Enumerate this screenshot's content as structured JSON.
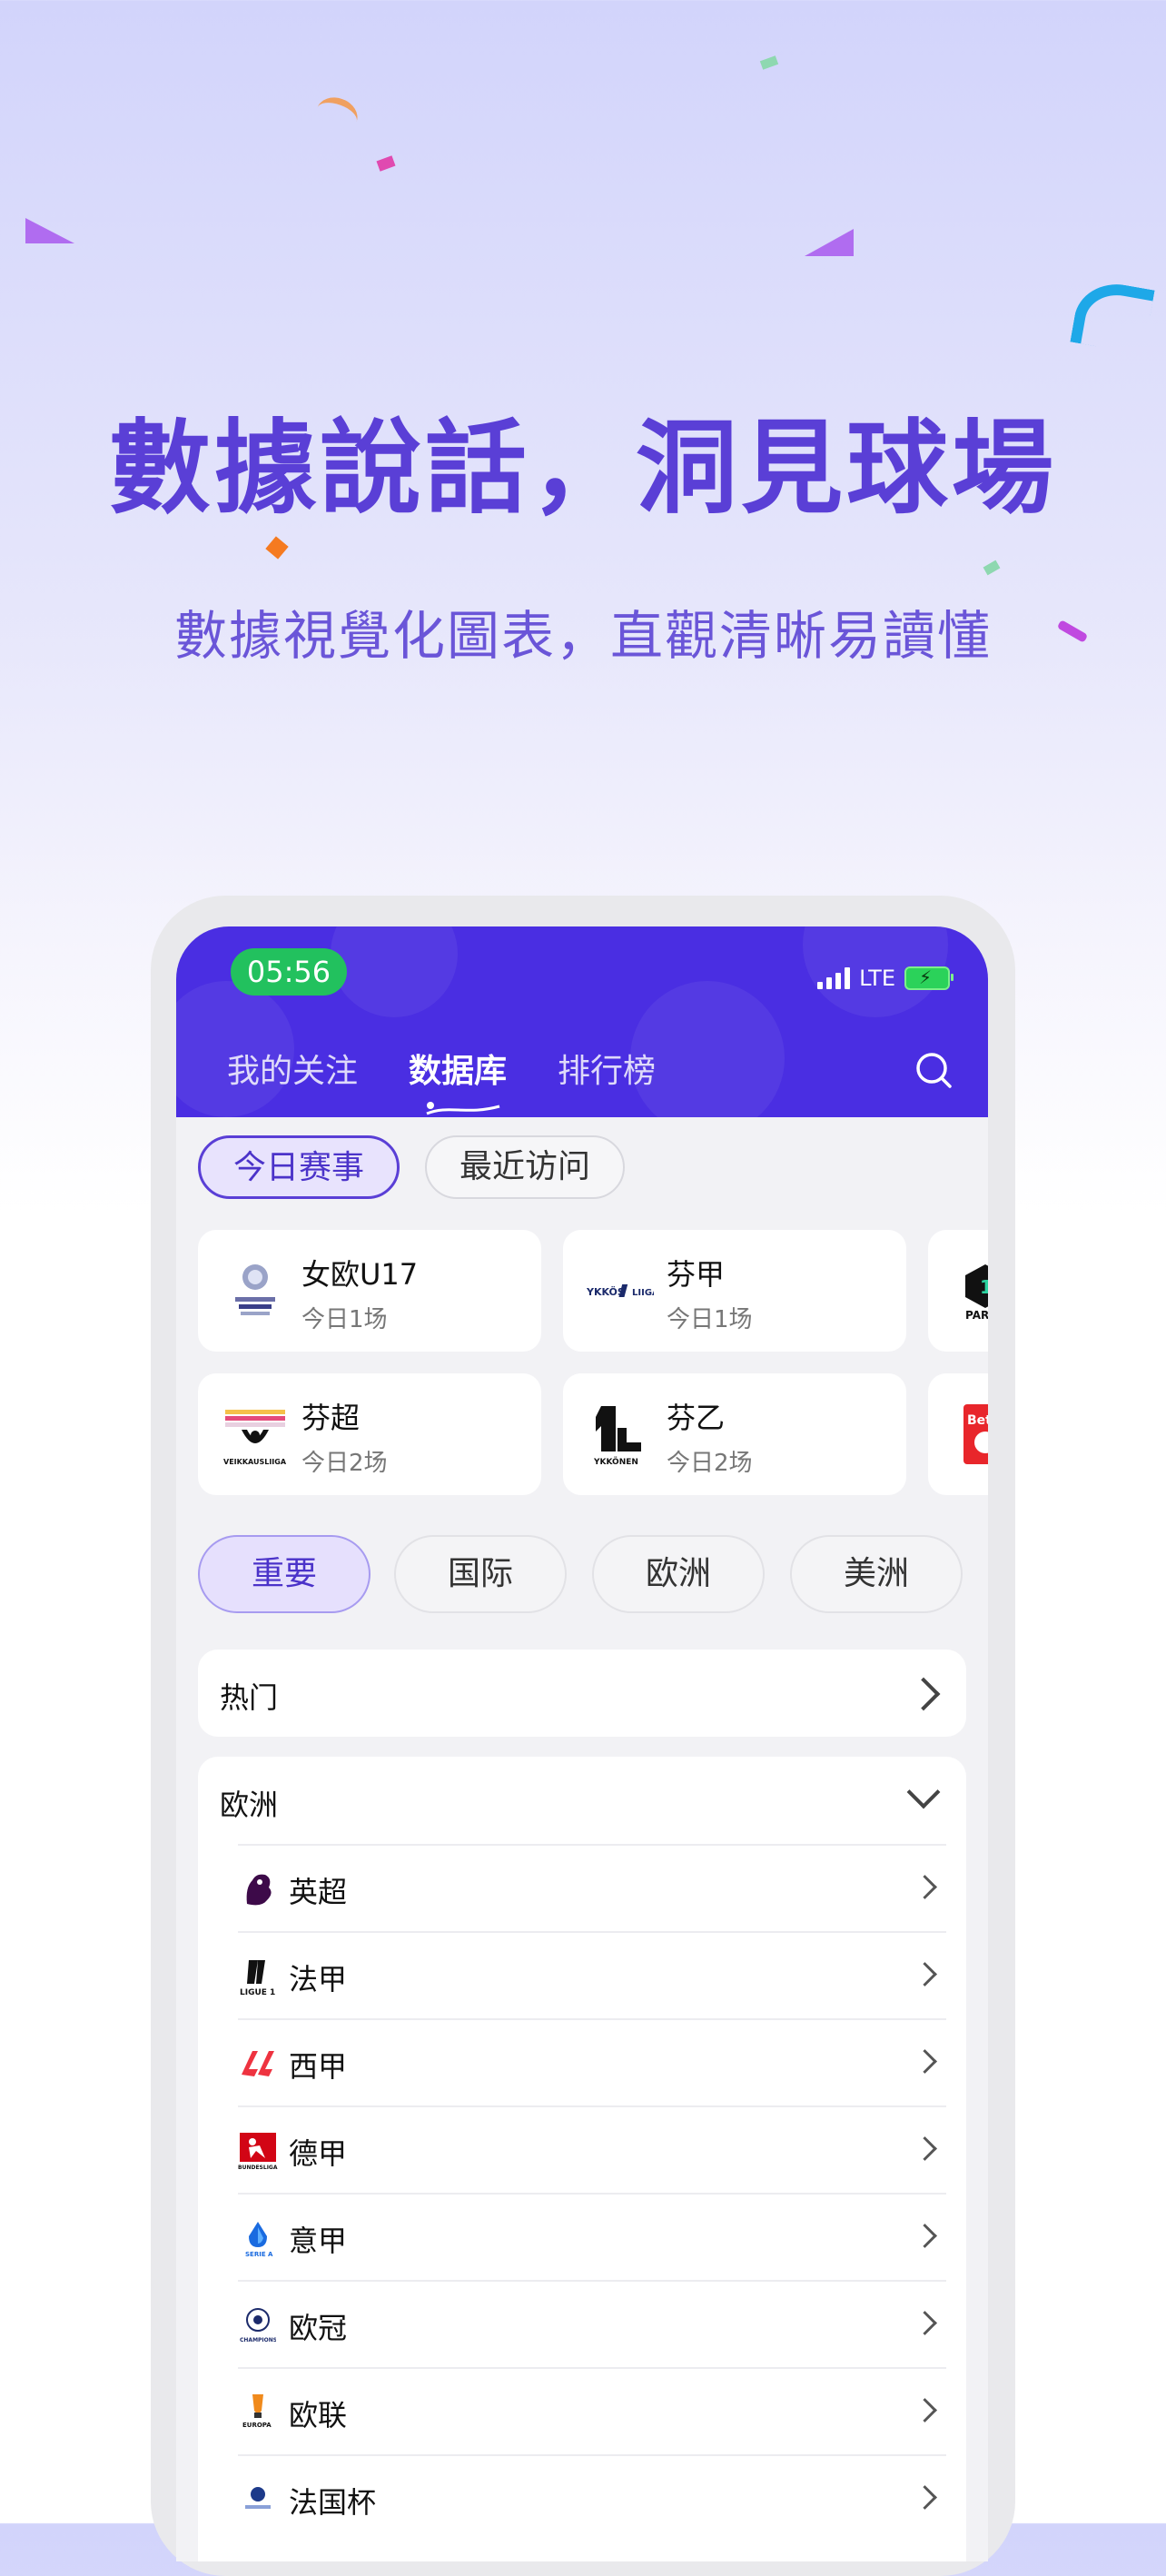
{
  "hero": {
    "title": "數據說話，洞見球場",
    "subtitle": "數據視覺化圖表，直觀清晰易讀懂"
  },
  "status_bar": {
    "time": "05:56",
    "network": "LTE",
    "time_pill_color": "#22c15e",
    "icons": [
      "signal-icon",
      "battery-charging-icon"
    ]
  },
  "nav": {
    "tabs": [
      {
        "label": "我的关注",
        "active": false
      },
      {
        "label": "数据库",
        "active": true
      },
      {
        "label": "排行榜",
        "active": false
      }
    ],
    "search_icon": "search-icon"
  },
  "filter_chips": [
    {
      "label": "今日赛事",
      "selected": true
    },
    {
      "label": "最近访问",
      "selected": false
    }
  ],
  "today_matches": [
    {
      "name": "女欧U17",
      "sub": "今日1场",
      "logo": "uefa-women-u17-logo"
    },
    {
      "name": "芬甲",
      "sub": "今日1场",
      "logo": "ykkosliiga-logo"
    },
    {
      "name": "",
      "sub": "",
      "logo": "partial-league-logo"
    },
    {
      "name": "芬超",
      "sub": "今日2场",
      "logo": "veikkausliiga-logo"
    },
    {
      "name": "芬乙",
      "sub": "今日2场",
      "logo": "ykkonen-logo"
    },
    {
      "name": "",
      "sub": "",
      "logo": "betsson-logo"
    }
  ],
  "regions": [
    {
      "label": "重要",
      "selected": true
    },
    {
      "label": "国际",
      "selected": false
    },
    {
      "label": "欧洲",
      "selected": false
    },
    {
      "label": "美洲",
      "selected": false
    }
  ],
  "sections": {
    "hot": {
      "label": "热门"
    },
    "europe": {
      "label": "欧洲",
      "leagues": [
        {
          "name": "英超",
          "logo": "premier-league-logo"
        },
        {
          "name": "法甲",
          "logo": "ligue1-logo"
        },
        {
          "name": "西甲",
          "logo": "laliga-logo"
        },
        {
          "name": "德甲",
          "logo": "bundesliga-logo"
        },
        {
          "name": "意甲",
          "logo": "serie-a-logo"
        },
        {
          "name": "欧冠",
          "logo": "champions-league-logo"
        },
        {
          "name": "欧联",
          "logo": "europa-league-logo"
        },
        {
          "name": "法国杯",
          "logo": "coupe-de-france-logo"
        }
      ]
    }
  },
  "colors": {
    "accent": "#5a3fd6",
    "header": "#4a2ee2",
    "selected_chip_bg": "#e8e3fd"
  }
}
